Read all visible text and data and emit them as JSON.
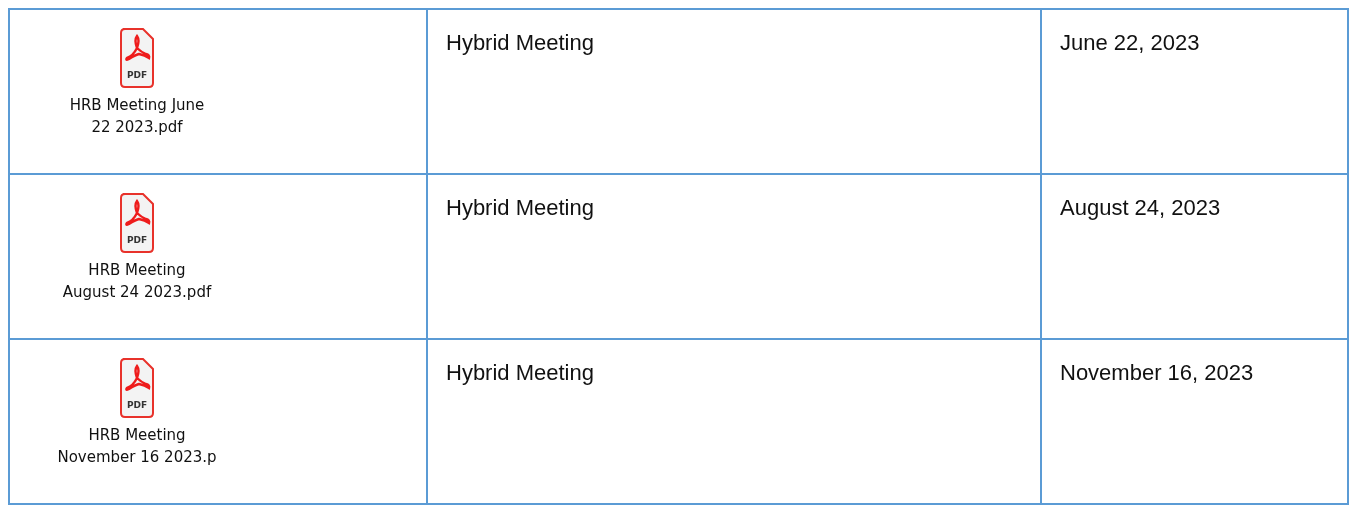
{
  "rows": [
    {
      "file": {
        "badge": "PDF",
        "name": "HRB Meeting June\n22 2023.pdf"
      },
      "meeting_type": "Hybrid Meeting",
      "date": "June 22, 2023"
    },
    {
      "file": {
        "badge": "PDF",
        "name": "HRB Meeting\nAugust 24 2023.pdf"
      },
      "meeting_type": "Hybrid Meeting",
      "date": "August 24, 2023"
    },
    {
      "file": {
        "badge": "PDF",
        "name": "HRB Meeting\nNovember 16 2023.p"
      },
      "meeting_type": "Hybrid Meeting",
      "date": "November 16, 2023"
    }
  ]
}
